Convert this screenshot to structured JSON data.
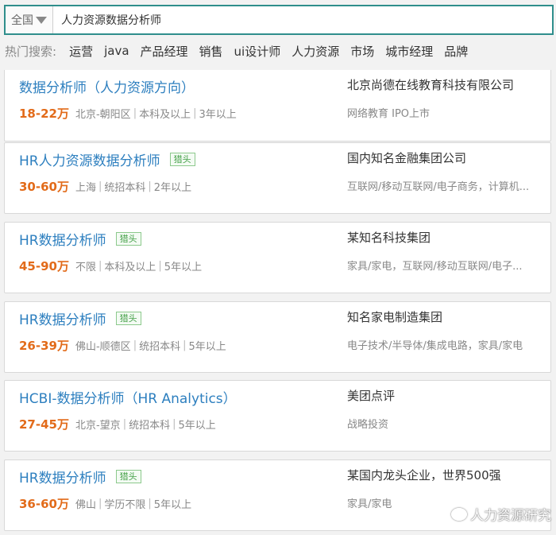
{
  "search": {
    "region": "全国",
    "query": "人力资源数据分析师"
  },
  "hot_searches": {
    "label": "热门搜索:",
    "items": [
      "运营",
      "java",
      "产品经理",
      "销售",
      "ui设计师",
      "人力资源",
      "市场",
      "城市经理",
      "品牌"
    ]
  },
  "jobs": [
    {
      "title": "数据分析师（人力资源方向）",
      "badge": "",
      "salary": "18-22万",
      "location": "北京-朝阳区",
      "education": "本科及以上",
      "experience": "3年以上",
      "company": "北京尚德在线教育科技有限公司",
      "industry": "网络教育 IPO上市"
    },
    {
      "title": "HR人力资源数据分析师",
      "badge": "猎头",
      "salary": "30-60万",
      "location": "上海",
      "education": "统招本科",
      "experience": "2年以上",
      "company": "国内知名金融集团公司",
      "industry": "互联网/移动互联网/电子商务，计算机..."
    },
    {
      "title": "HR数据分析师",
      "badge": "猎头",
      "salary": "45-90万",
      "location": "不限",
      "education": "本科及以上",
      "experience": "5年以上",
      "company": "某知名科技集团",
      "industry": "家具/家电，互联网/移动互联网/电子..."
    },
    {
      "title": "HR数据分析师",
      "badge": "猎头",
      "salary": "26-39万",
      "location": "佛山-顺德区",
      "education": "统招本科",
      "experience": "5年以上",
      "company": "知名家电制造集团",
      "industry": "电子技术/半导体/集成电路，家具/家电"
    },
    {
      "title": "HCBI-数据分析师（HR Analytics）",
      "badge": "",
      "salary": "27-45万",
      "location": "北京-望京",
      "education": "统招本科",
      "experience": "5年以上",
      "company": "美团点评",
      "industry": "战略投资"
    },
    {
      "title": "HR数据分析师",
      "badge": "猎头",
      "salary": "36-60万",
      "location": "佛山",
      "education": "学历不限",
      "experience": "5年以上",
      "company": "某国内龙头企业，世界500强",
      "industry": "家具/家电"
    }
  ],
  "watermark": "人力资源研究",
  "colors": {
    "title_blue": "#2d7fbf",
    "salary_orange": "#e26b1a",
    "badge_green": "#43a047",
    "search_border": "#2f8e8c"
  }
}
